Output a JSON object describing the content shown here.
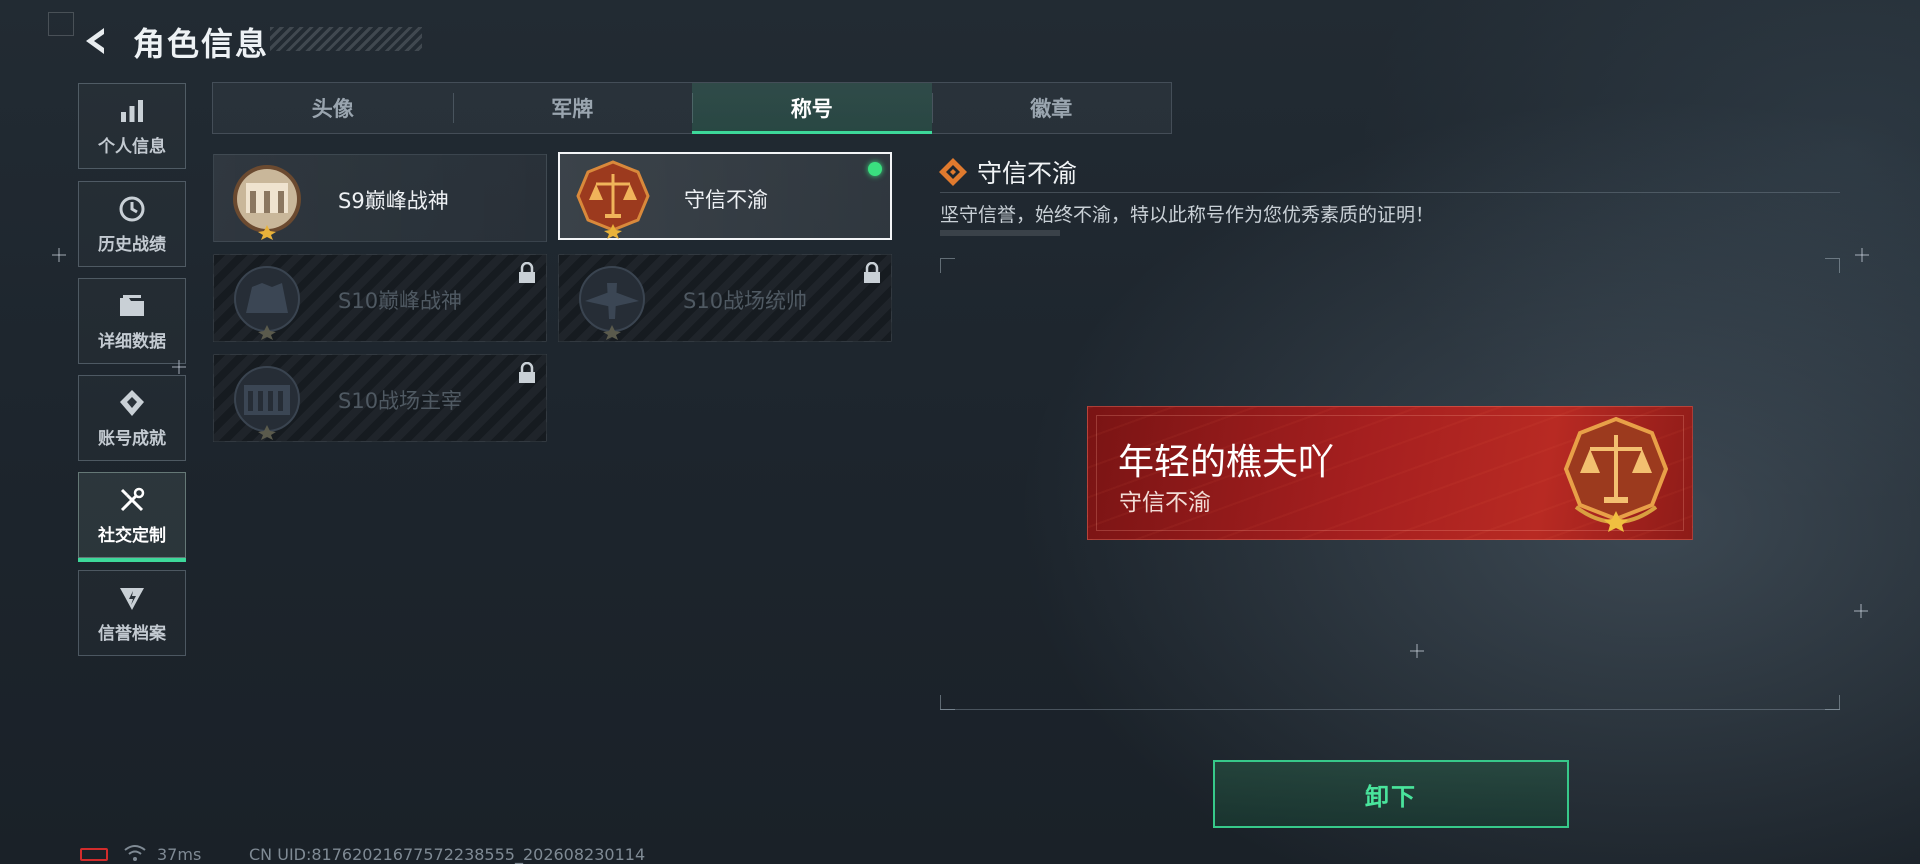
{
  "header": {
    "title": "角色信息"
  },
  "sidebar": {
    "items": [
      {
        "label": "个人信息",
        "icon": "bar-chart-icon"
      },
      {
        "label": "历史战绩",
        "icon": "history-clock-icon"
      },
      {
        "label": "详细数据",
        "icon": "folder-icon"
      },
      {
        "label": "账号成就",
        "icon": "achievement-icon"
      },
      {
        "label": "社交定制",
        "icon": "tools-icon",
        "active": true
      },
      {
        "label": "信誉档案",
        "icon": "credit-shield-icon"
      }
    ]
  },
  "tabs": [
    {
      "label": "头像"
    },
    {
      "label": "军牌"
    },
    {
      "label": "称号",
      "active": true
    },
    {
      "label": "徽章"
    }
  ],
  "titles": [
    {
      "name": "S9巅峰战神",
      "locked": false
    },
    {
      "name": "守信不渝",
      "locked": false,
      "selected": true,
      "equipped": true
    },
    {
      "name": "S10巅峰战神",
      "locked": true
    },
    {
      "name": "S10战场统帅",
      "locked": true
    },
    {
      "name": "S10战场主宰",
      "locked": true
    }
  ],
  "detail": {
    "name": "守信不渝",
    "description": "坚守信誉，始终不渝，特以此称号作为您优秀素质的证明！"
  },
  "banner": {
    "player_name": "年轻的樵夫吖",
    "title": "守信不渝"
  },
  "actions": {
    "unequip_label": "卸下"
  },
  "status": {
    "ping": "37ms",
    "uid": "CN UID:81762021677572238555_202608230114"
  },
  "colors": {
    "accent": "#3dd89a",
    "equipped_dot": "#3ae07f",
    "banner_red": "#a51f1f",
    "battery_red": "#d22c2c"
  }
}
